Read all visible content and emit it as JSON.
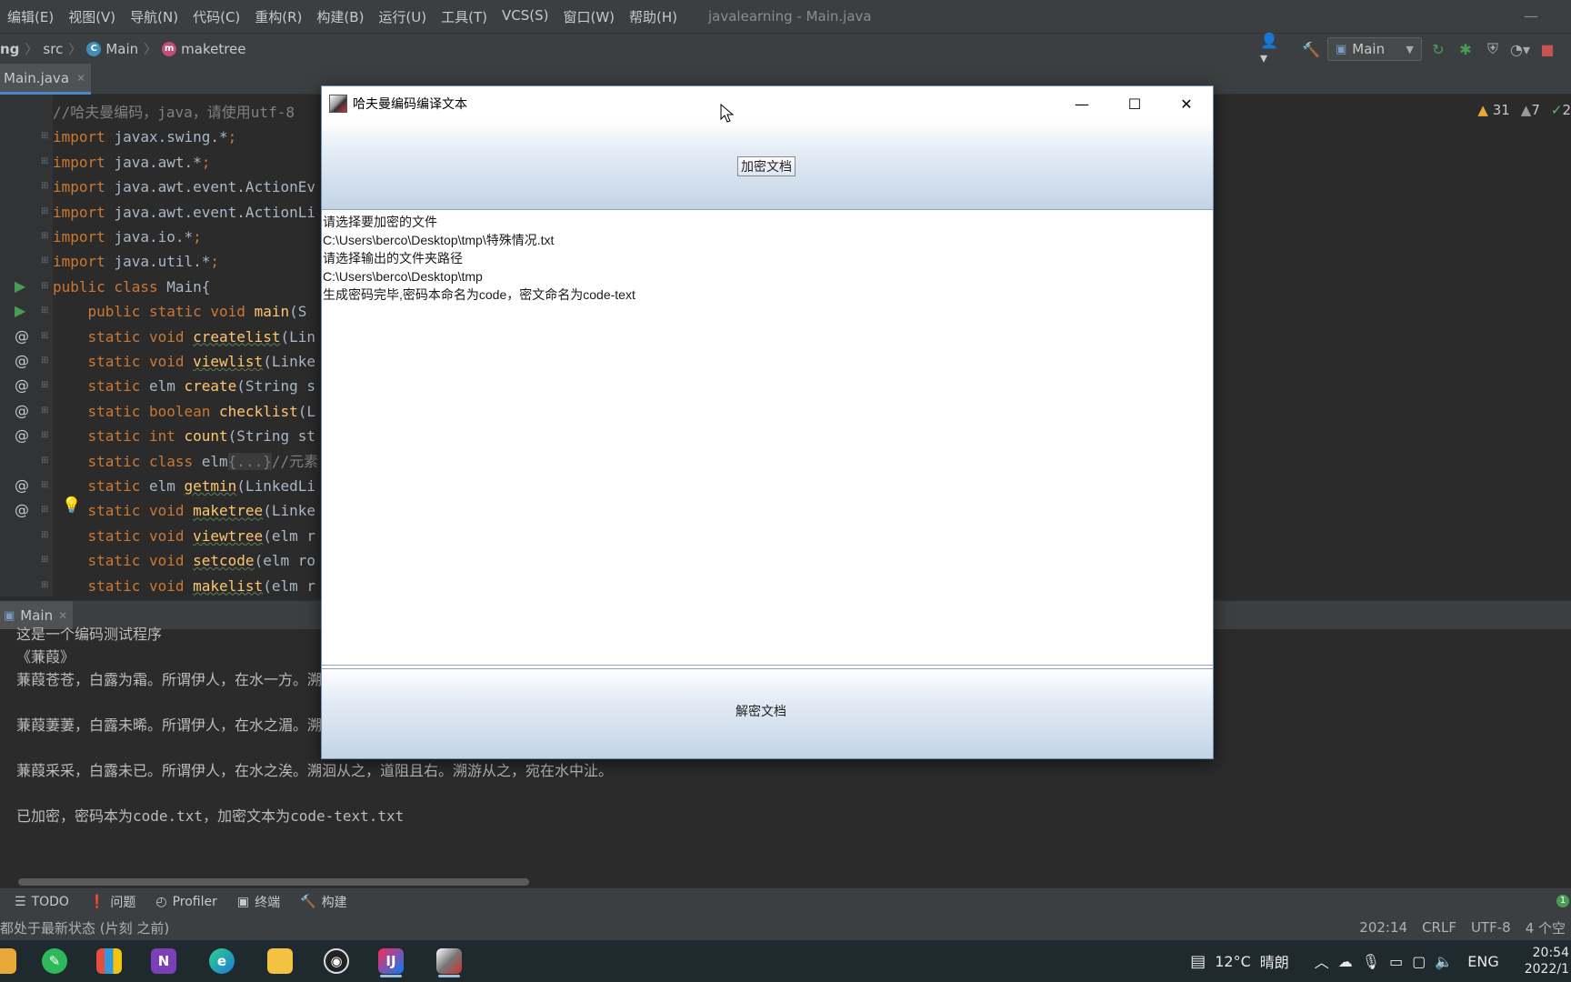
{
  "menu": {
    "items": [
      "编辑(E)",
      "视图(V)",
      "导航(N)",
      "代码(C)",
      "重构(R)",
      "构建(B)",
      "运行(U)",
      "工具(T)",
      "VCS(S)",
      "窗口(W)",
      "帮助(H)"
    ],
    "window_title": "javalearning - Main.java",
    "minimize": "—"
  },
  "breadcrumb": {
    "project": "ng",
    "src": "src",
    "class": "Main",
    "method": "maketree"
  },
  "toolbar": {
    "run_config": "Main"
  },
  "editor": {
    "tab_label": "Main.java",
    "lines": [
      {
        "parts": [
          [
            "cm",
            "//哈夫曼编码，java，请使用utf-8"
          ]
        ]
      },
      {
        "parts": [
          [
            "kw",
            "import "
          ],
          [
            "",
            "javax.swing.*"
          ],
          [
            "kw",
            ";"
          ]
        ]
      },
      {
        "parts": [
          [
            "kw",
            "import "
          ],
          [
            "",
            "java.awt.*"
          ],
          [
            "kw",
            ";"
          ]
        ]
      },
      {
        "parts": [
          [
            "kw",
            "import "
          ],
          [
            "",
            "java.awt.event.ActionEv"
          ]
        ]
      },
      {
        "parts": [
          [
            "kw",
            "import "
          ],
          [
            "",
            "java.awt.event.ActionLi"
          ]
        ]
      },
      {
        "parts": [
          [
            "kw",
            "import "
          ],
          [
            "",
            "java.io.*"
          ],
          [
            "kw",
            ";"
          ]
        ]
      },
      {
        "parts": [
          [
            "kw",
            "import "
          ],
          [
            "",
            "java.util.*"
          ],
          [
            "kw",
            ";"
          ]
        ]
      },
      {
        "parts": [
          [
            "kw",
            "public class "
          ],
          [
            "",
            "Main{"
          ]
        ]
      },
      {
        "parts": [
          [
            "",
            "    "
          ],
          [
            "kw",
            "public static void "
          ],
          [
            "fnp",
            "main"
          ],
          [
            "",
            "(S"
          ]
        ]
      },
      {
        "parts": [
          [
            "",
            "    "
          ],
          [
            "kw",
            "static void "
          ],
          [
            "fn",
            "createlist"
          ],
          [
            "",
            "(Lin"
          ]
        ]
      },
      {
        "parts": [
          [
            "",
            "    "
          ],
          [
            "kw",
            "static void "
          ],
          [
            "fn",
            "viewlist"
          ],
          [
            "",
            "(Linke"
          ]
        ]
      },
      {
        "parts": [
          [
            "",
            "    "
          ],
          [
            "kw",
            "static "
          ],
          [
            "",
            "elm "
          ],
          [
            "fnp",
            "create"
          ],
          [
            "",
            "(String s"
          ]
        ]
      },
      {
        "parts": [
          [
            "",
            "    "
          ],
          [
            "kw",
            "static boolean "
          ],
          [
            "fnp",
            "checklist"
          ],
          [
            "",
            "(L"
          ]
        ]
      },
      {
        "parts": [
          [
            "",
            "    "
          ],
          [
            "kw",
            "static int "
          ],
          [
            "fnp",
            "count"
          ],
          [
            "",
            "(String st"
          ]
        ]
      },
      {
        "parts": [
          [
            "",
            "    "
          ],
          [
            "kw",
            "static class "
          ],
          [
            "",
            "elm"
          ],
          [
            "fold",
            "{...}"
          ],
          [
            "cm",
            "//元素"
          ]
        ]
      },
      {
        "parts": [
          [
            "",
            "    "
          ],
          [
            "kw",
            "static "
          ],
          [
            "",
            "elm "
          ],
          [
            "fn",
            "getmin"
          ],
          [
            "",
            "(LinkedLi"
          ]
        ]
      },
      {
        "parts": [
          [
            "",
            "    "
          ],
          [
            "kw",
            "static void "
          ],
          [
            "fn",
            "maketree"
          ],
          [
            "",
            "(Linke"
          ]
        ]
      },
      {
        "parts": [
          [
            "",
            "    "
          ],
          [
            "kw",
            "static void "
          ],
          [
            "fn",
            "viewtree"
          ],
          [
            "",
            "(elm r"
          ]
        ]
      },
      {
        "parts": [
          [
            "",
            "    "
          ],
          [
            "kw",
            "static void "
          ],
          [
            "fn",
            "setcode"
          ],
          [
            "",
            "(elm ro"
          ]
        ]
      },
      {
        "parts": [
          [
            "",
            "    "
          ],
          [
            "kw",
            "static void "
          ],
          [
            "fn",
            "makelist"
          ],
          [
            "",
            "(elm r"
          ]
        ]
      }
    ],
    "gutter_marks": [
      {
        "line": 7,
        "mark": "▶",
        "type": "run"
      },
      {
        "line": 8,
        "mark": "▶",
        "type": "run"
      },
      {
        "line": 9,
        "mark": "@",
        "type": "at"
      },
      {
        "line": 10,
        "mark": "@",
        "type": "at"
      },
      {
        "line": 11,
        "mark": "@",
        "type": "at"
      },
      {
        "line": 12,
        "mark": "@",
        "type": "at"
      },
      {
        "line": 13,
        "mark": "@",
        "type": "at"
      },
      {
        "line": 15,
        "mark": "@",
        "type": "at"
      },
      {
        "line": 16,
        "mark": "@",
        "type": "at"
      }
    ],
    "inspections": {
      "warnings": "31",
      "weak": "7",
      "ok": "2"
    }
  },
  "run_panel": {
    "tab_label": "Main",
    "console_lines": [
      "这是一个编码测试程序",
      "《蒹葭》",
      "蒹葭苍苍，白露为霜。所谓伊人，在水一方。溯",
      "",
      "蒹葭萋萋，白露未晞。所谓伊人，在水之湄。溯",
      "",
      "蒹葭采采，白露未已。所谓伊人，在水之涘。溯洄从之，道阻且右。溯游从之，宛在水中沚。",
      "",
      "已加密，密码本为code.txt，加密文本为code-text.txt"
    ]
  },
  "tool_tabs": [
    "TODO",
    "问题",
    "Profiler",
    "终端",
    "构建"
  ],
  "status": {
    "message": "都处于最新状态 (片刻 之前)",
    "position": "202:14",
    "line_sep": "CRLF",
    "encoding": "UTF-8",
    "indent": "4 个空",
    "notif_count": "1"
  },
  "dialog": {
    "title": "哈夫曼编码编译文本",
    "encrypt_button": "加密文档",
    "decrypt_button": "解密文档",
    "text_lines": [
      "请选择要加密的文件",
      "C:\\Users\\berco\\Desktop\\tmp\\特殊情况.txt",
      "请选择输出的文件夹路径",
      "C:\\Users\\berco\\Desktop\\tmp",
      "生成密码完毕,密码本命名为code，密文命名为code-text"
    ]
  },
  "taskbar": {
    "weather_temp": "12°C",
    "weather_text": "晴朗",
    "lang": "ENG",
    "time": "20:54",
    "date": "2022/1"
  },
  "colors": {
    "ide_bg": "#2b2b2b",
    "panel_bg": "#3c3f41",
    "keyword": "#cc7832",
    "function": "#ffc66d",
    "run_green": "#499c54"
  }
}
